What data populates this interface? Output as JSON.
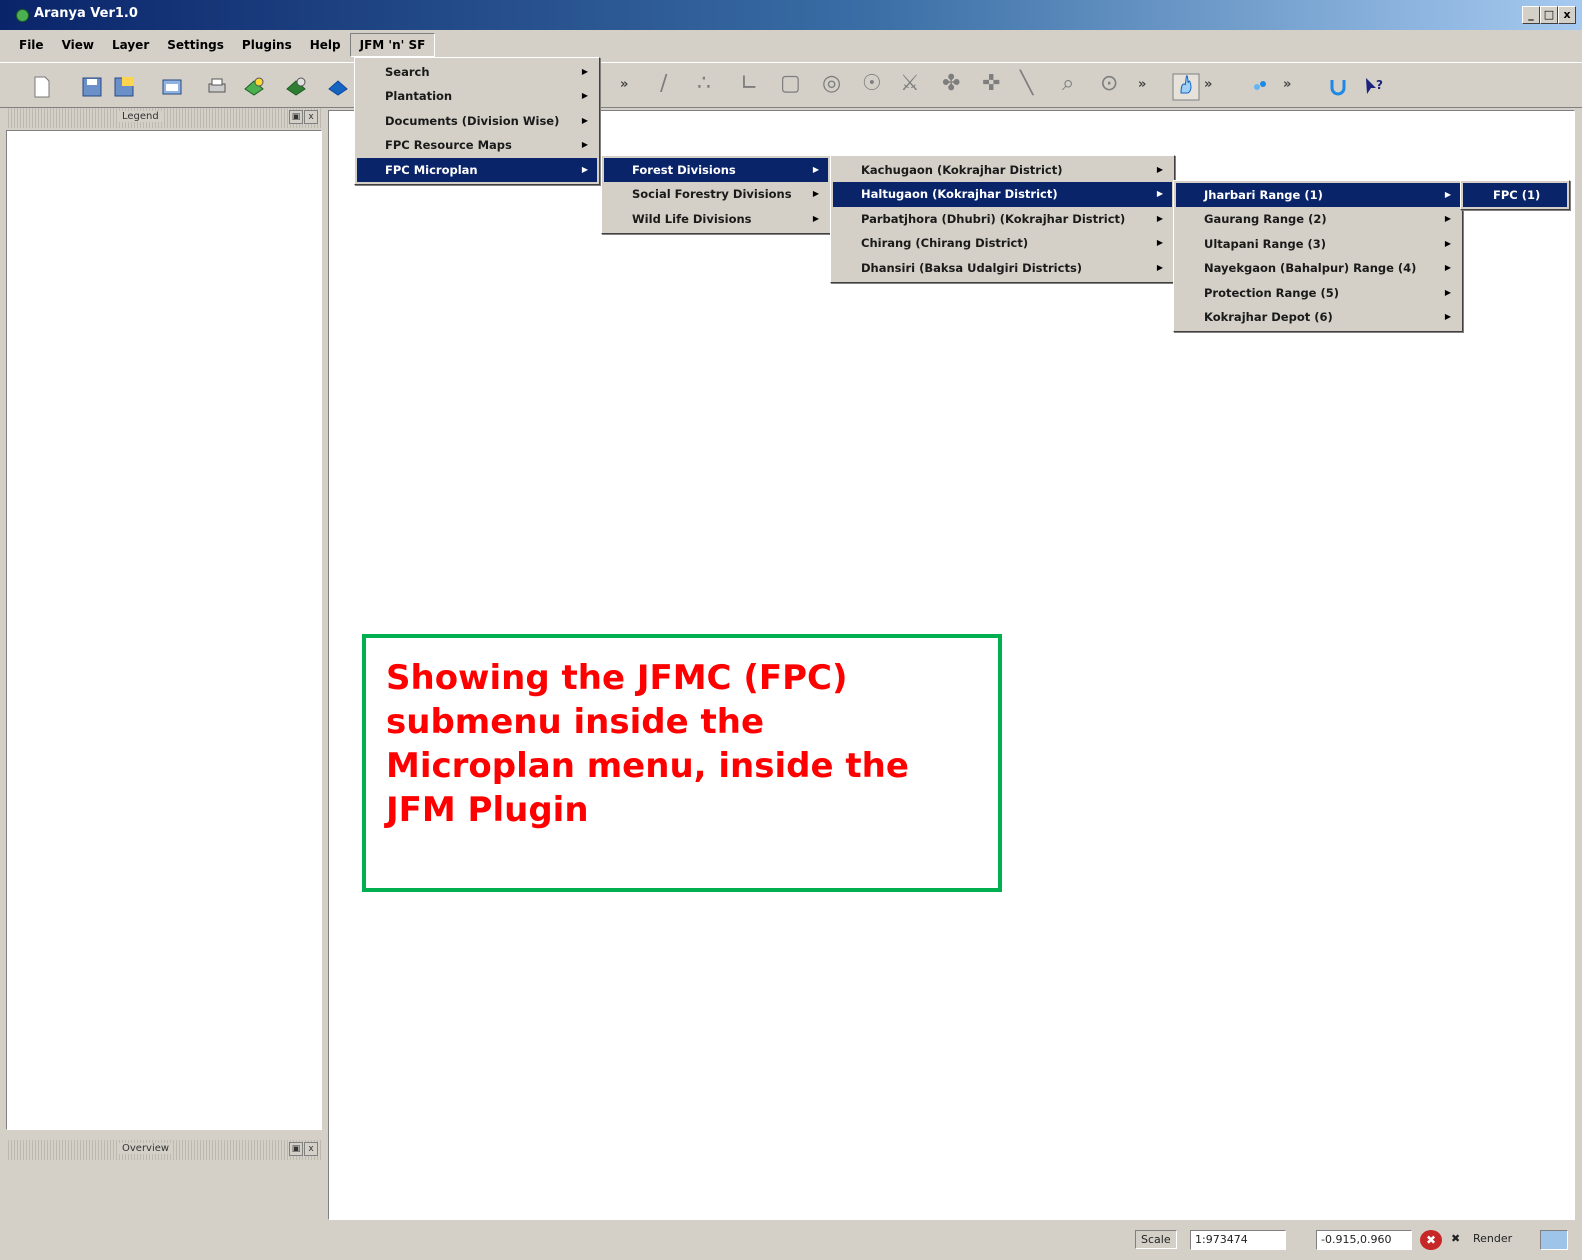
{
  "window": {
    "title": "Aranya Ver1.0",
    "min": "_",
    "max": "□",
    "close": "x"
  },
  "menubar": [
    "File",
    "View",
    "Layer",
    "Settings",
    "Plugins",
    "Help",
    "JFM 'n' SF"
  ],
  "toolbar": {
    "overflow": "»"
  },
  "legend": {
    "title": "Legend",
    "float": "▣",
    "close": "x"
  },
  "overview": {
    "title": "Overview",
    "float": "▣",
    "close": "x"
  },
  "menus": {
    "jfm": [
      "Search",
      "Plantation",
      "Documents (Division Wise)",
      "FPC Resource Maps",
      "FPC Microplan"
    ],
    "microplan": [
      "Forest Divisions",
      "Social Forestry Divisions",
      "Wild Life Divisions"
    ],
    "forest_divisions": [
      "Kachugaon (Kokrajhar District)",
      "Haltugaon (Kokrajhar District)",
      "Parbatjhora (Dhubri) (Kokrajhar District)",
      "Chirang (Chirang District)",
      "Dhansiri (Baksa Udalgiri Districts)"
    ],
    "haltugaon": [
      "Jharbari Range (1)",
      "Gaurang Range (2)",
      "Ultapani Range (3)",
      "Nayekgaon (Bahalpur) Range (4)",
      "Protection Range (5)",
      "Kokrajhar Depot (6)"
    ],
    "jharbari": [
      "FPC (1)"
    ]
  },
  "annotation": {
    "lines": [
      "Showing the JFMC (FPC)",
      "submenu inside the",
      "Microplan menu, inside the",
      "JFM Plugin"
    ],
    "border_color": "#00b050",
    "text_color": "#ff0000"
  },
  "statusbar": {
    "scale_label": "Scale",
    "scale_value": "1:973474",
    "coords": "-0.915,0.960",
    "render_label": "Render"
  },
  "colors": {
    "selection": "#0a246a",
    "chrome": "#d4d0c8"
  }
}
